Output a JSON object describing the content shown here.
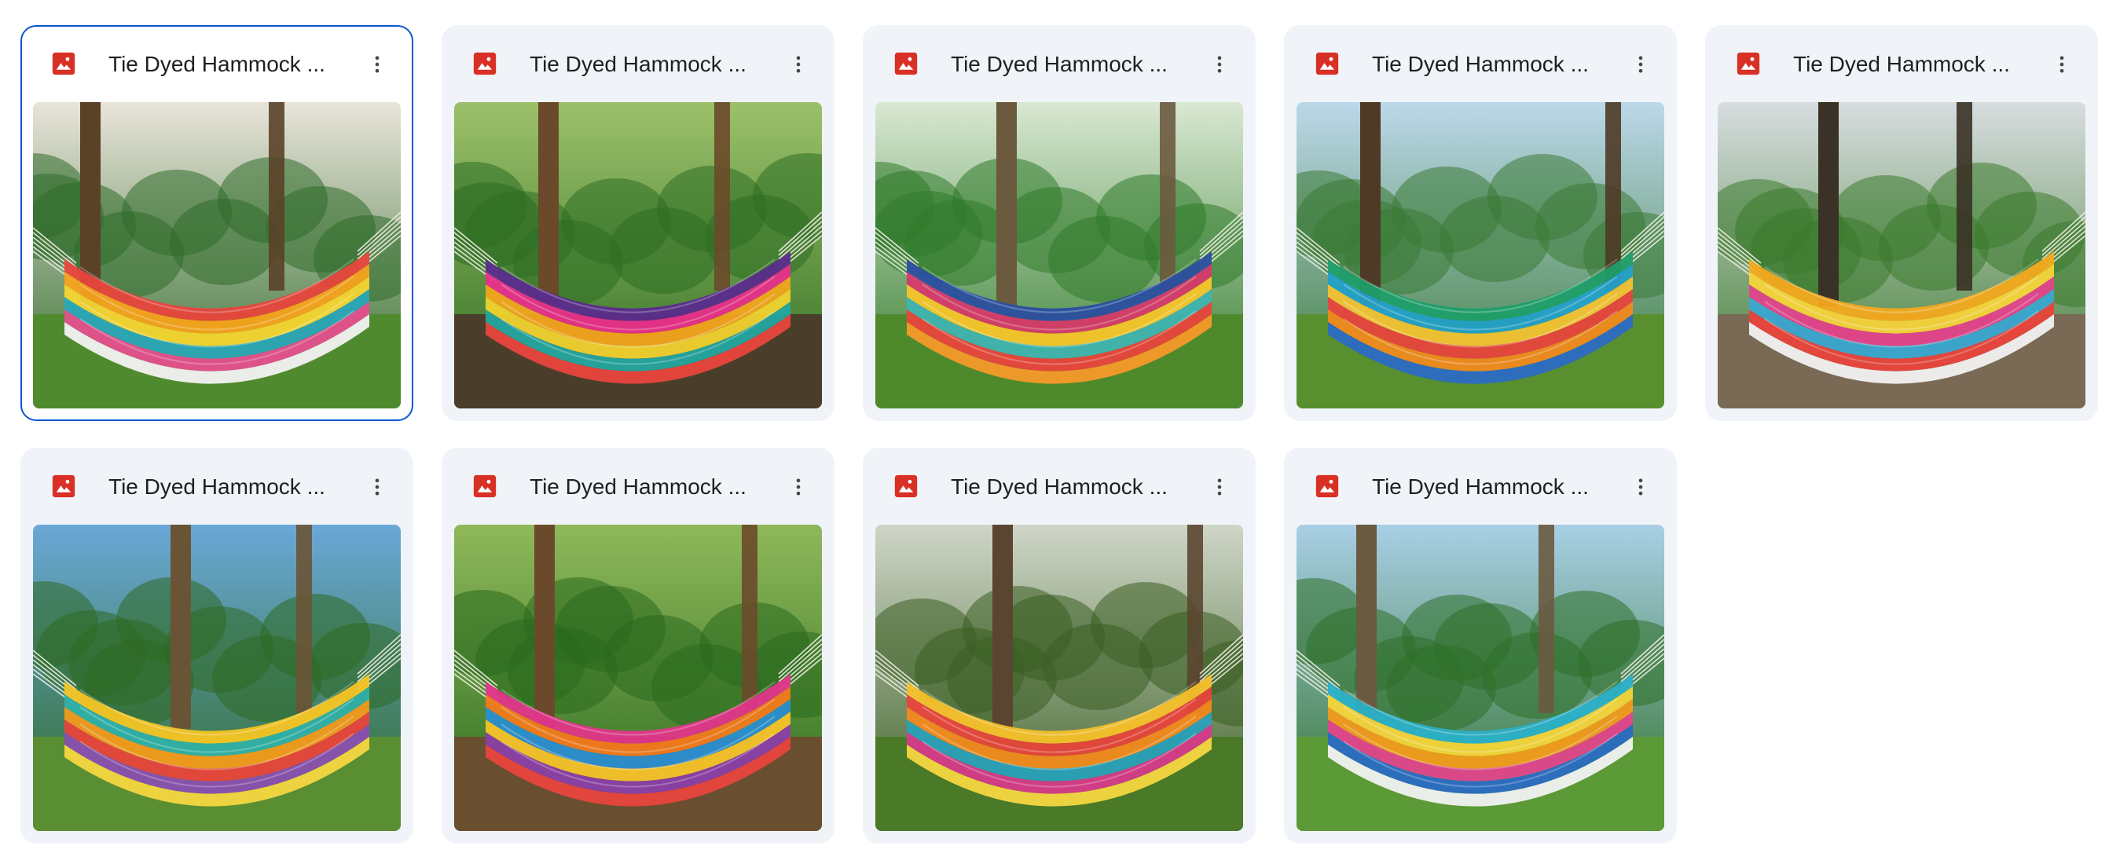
{
  "files": [
    {
      "name": "Tie Dyed Hammock ...",
      "icon": "image-file-icon",
      "menu_icon": "more-vert-icon",
      "selected": true,
      "scene": {
        "sky": "#e9e4da",
        "foliage": "#2f6b2a",
        "ground": "#4f8a2e",
        "trunk": "#5a4128",
        "bands": [
          "#e8453c",
          "#f7a21b",
          "#f5d531",
          "#2aa6b8",
          "#e54f8e",
          "#f2f2f2"
        ]
      }
    },
    {
      "name": "Tie Dyed Hammock ...",
      "icon": "image-file-icon",
      "menu_icon": "more-vert-icon",
      "selected": false,
      "scene": {
        "sky": "#9cc06a",
        "foliage": "#2e6e22",
        "ground": "#4a3e2a",
        "trunk": "#6a4a2a",
        "bands": [
          "#5b2c8c",
          "#e8308a",
          "#f2a51c",
          "#f0d22e",
          "#23a6a0",
          "#e8453c"
        ]
      }
    },
    {
      "name": "Tie Dyed Hammock ...",
      "icon": "image-file-icon",
      "menu_icon": "more-vert-icon",
      "selected": false,
      "scene": {
        "sky": "#d9e8d2",
        "foliage": "#2f7a2a",
        "ground": "#4e8a2c",
        "trunk": "#6b5a3e",
        "bands": [
          "#2b4fa0",
          "#d63a6a",
          "#f6c52a",
          "#3fb4b0",
          "#e8453c",
          "#f59a2a"
        ]
      }
    },
    {
      "name": "Tie Dyed Hammock ...",
      "icon": "image-file-icon",
      "menu_icon": "more-vert-icon",
      "selected": false,
      "scene": {
        "sky": "#bcd8ea",
        "foliage": "#3a7a35",
        "ground": "#58902f",
        "trunk": "#4e3a26",
        "bands": [
          "#1f9e6a",
          "#23a0c8",
          "#f3c233",
          "#e8453c",
          "#f08a1e",
          "#2b6cc4"
        ]
      }
    },
    {
      "name": "Tie Dyed Hammock ...",
      "icon": "image-file-icon",
      "menu_icon": "more-vert-icon",
      "selected": false,
      "scene": {
        "sky": "#d8dde0",
        "foliage": "#3b7a2b",
        "ground": "#7a6a55",
        "trunk": "#3a3226",
        "bands": [
          "#f3a91d",
          "#f5d43a",
          "#e2458c",
          "#3aa8d0",
          "#e8453c",
          "#f2f2f2"
        ]
      }
    },
    {
      "name": "Tie Dyed Hammock ...",
      "icon": "image-file-icon",
      "menu_icon": "more-vert-icon",
      "selected": false,
      "scene": {
        "sky": "#6aa8d8",
        "foliage": "#2d6a22",
        "ground": "#5a8e32",
        "trunk": "#6a5436",
        "bands": [
          "#f5c524",
          "#2fb0a8",
          "#f29a1c",
          "#e8453c",
          "#8a4fb0",
          "#f5d740"
        ]
      }
    },
    {
      "name": "Tie Dyed Hammock ...",
      "icon": "image-file-icon",
      "menu_icon": "more-vert-icon",
      "selected": false,
      "scene": {
        "sky": "#8fb85a",
        "foliage": "#2a6a1e",
        "ground": "#6a4e30",
        "trunk": "#6a4a2a",
        "bands": [
          "#e2358a",
          "#f27a1c",
          "#2a8ed0",
          "#f5c32a",
          "#8a3fa8",
          "#e8453c"
        ]
      }
    },
    {
      "name": "Tie Dyed Hammock ...",
      "icon": "image-file-icon",
      "menu_icon": "more-vert-icon",
      "selected": false,
      "scene": {
        "sky": "#cfd6c8",
        "foliage": "#3a5e22",
        "ground": "#4a7a28",
        "trunk": "#5a4630",
        "bands": [
          "#f6c02a",
          "#e8453c",
          "#f28a1e",
          "#2aa0b8",
          "#d63a8a",
          "#f5d740"
        ]
      }
    },
    {
      "name": "Tie Dyed Hammock ...",
      "icon": "image-file-icon",
      "menu_icon": "more-vert-icon",
      "selected": false,
      "scene": {
        "sky": "#a9cfe6",
        "foliage": "#2e7028",
        "ground": "#5b9a36",
        "trunk": "#6a5a40",
        "bands": [
          "#2ab0c8",
          "#f5d43a",
          "#f29a1c",
          "#e2458c",
          "#2b6cc4",
          "#f2f2f2"
        ]
      }
    }
  ],
  "colors": {
    "card_bg": "#f0f4f9",
    "selected_border": "#0b57d0",
    "image_icon": "#d93025",
    "text": "#1f1f1f",
    "menu_dots": "#444746"
  }
}
